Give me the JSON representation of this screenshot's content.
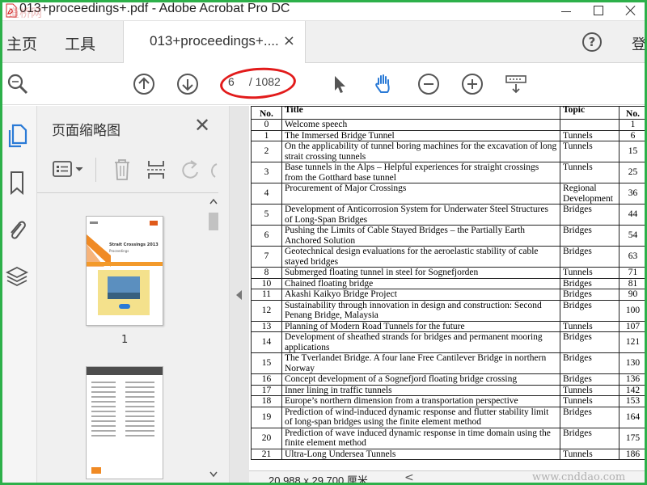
{
  "window": {
    "title": "013+proceedings+.pdf - Adobe Acrobat Pro DC",
    "watermark_logo": "道桥网"
  },
  "tabs": {
    "home": "主页",
    "tools": "工具",
    "document": "013+proceedings+....",
    "document_close": "×",
    "help": "?",
    "signin": "登"
  },
  "toolbar": {
    "current_page": "6",
    "total_pages": "/ 1082"
  },
  "thumbnail_panel": {
    "title": "页面缩略图",
    "close": "✕",
    "thumb1_label": "1",
    "thumb1_heading": "Strait Crossings 2013",
    "thumb1_sub": "Proceedings"
  },
  "statusbar": {
    "page_size": "20.988 x 29.700 厘米",
    "watermark": "www.cnddao.com"
  },
  "toc": {
    "headers": [
      "No.",
      "Title",
      "Topic",
      "No."
    ],
    "rows": [
      {
        "no": "0",
        "title": "Welcome speech",
        "topic": "",
        "page": "1"
      },
      {
        "no": "1",
        "title": "The Immersed Bridge Tunnel",
        "topic": "Tunnels",
        "page": "6"
      },
      {
        "no": "2",
        "title": "On the applicability of tunnel boring machines for the excavation of long strait crossing tunnels",
        "topic": "Tunnels",
        "page": "15"
      },
      {
        "no": "3",
        "title": "Base tunnels in the Alps – Helpful experiences for straight crossings from the Gotthard base tunnel",
        "topic": "Tunnels",
        "page": "25"
      },
      {
        "no": "4",
        "title": "Procurement of Major Crossings",
        "topic": "Regional Development",
        "page": "36"
      },
      {
        "no": "5",
        "title": "Development of Anticorrosion System for Underwater Steel Structures of Long-Span Bridges",
        "topic": "Bridges",
        "page": "44"
      },
      {
        "no": "6",
        "title": "Pushing the Limits of Cable Stayed Bridges – the Partially Earth Anchored Solution",
        "topic": "Bridges",
        "page": "54"
      },
      {
        "no": "7",
        "title": "Geotechnical design evaluations for the aeroelastic stability of cable stayed bridges",
        "topic": "Bridges",
        "page": "63"
      },
      {
        "no": "8",
        "title": "Submerged floating tunnel in steel for Sognefjorden",
        "topic": "Tunnels",
        "page": "71"
      },
      {
        "no": "10",
        "title": "Chained floating bridge",
        "topic": "Bridges",
        "page": "81"
      },
      {
        "no": "11",
        "title": "Akashi Kaikyo Bridge Project",
        "topic": "Bridges",
        "page": "90"
      },
      {
        "no": "12",
        "title": "Sustainability through innovation in design and construction: Second Penang Bridge, Malaysia",
        "topic": "Bridges",
        "page": "100"
      },
      {
        "no": "13",
        "title": "Planning of Modern Road Tunnels for the future",
        "topic": "Tunnels",
        "page": "107"
      },
      {
        "no": "14",
        "title": "Development of sheathed strands for bridges and permanent mooring applications",
        "topic": "Bridges",
        "page": "121"
      },
      {
        "no": "15",
        "title": "The Tverlandet Bridge. A four lane Free Cantilever Bridge in northern Norway",
        "topic": "Bridges",
        "page": "130"
      },
      {
        "no": "16",
        "title": "Concept development of a Sognefjord floating bridge crossing",
        "topic": "Bridges",
        "page": "136"
      },
      {
        "no": "17",
        "title": "Inner lining in traffic tunnels",
        "topic": "Tunnels",
        "page": "142"
      },
      {
        "no": "18",
        "title": "Europe’s northern dimension from a transportation perspective",
        "topic": "Tunnels",
        "page": "153"
      },
      {
        "no": "19",
        "title": "Prediction of wind-induced dynamic response and flutter stability limit of long-span bridges using the finite element method",
        "topic": "Bridges",
        "page": "164"
      },
      {
        "no": "20",
        "title": "Prediction of wave induced dynamic response in time domain using the finite element method",
        "topic": "Bridges",
        "page": "175"
      },
      {
        "no": "21",
        "title": "Ultra-Long Undersea Tunnels",
        "topic": "Tunnels",
        "page": "186"
      }
    ]
  }
}
